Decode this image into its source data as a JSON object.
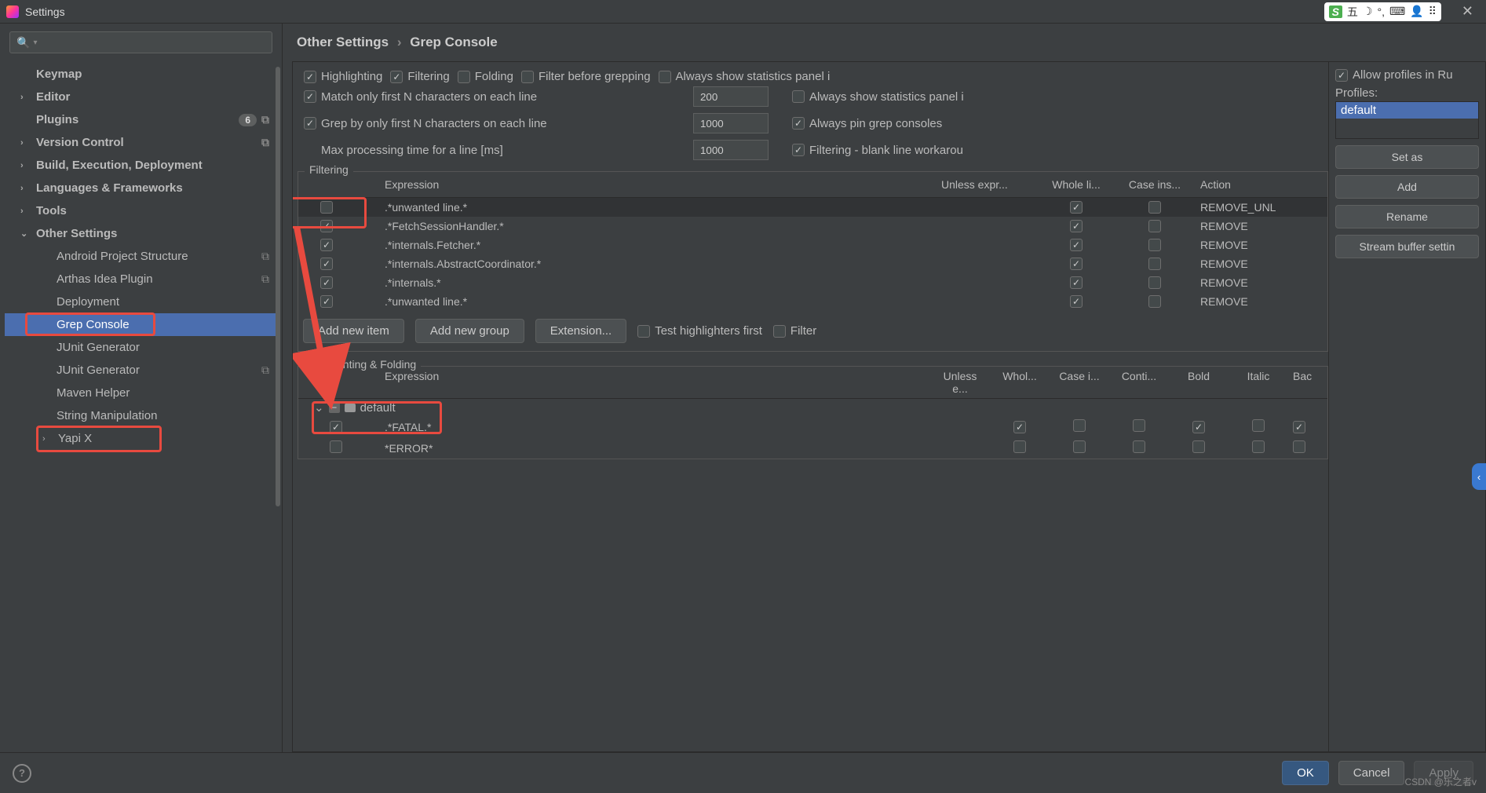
{
  "titlebar": {
    "title": "Settings"
  },
  "ime": {
    "items": [
      "五",
      "☽",
      "°,",
      "⌨",
      "👤",
      "⠿"
    ]
  },
  "sidebar": {
    "items": [
      {
        "label": "Keymap",
        "bold": true,
        "chev": "",
        "lvl": 1
      },
      {
        "label": "Editor",
        "bold": true,
        "chev": "›",
        "lvl": 1
      },
      {
        "label": "Plugins",
        "bold": true,
        "chev": "",
        "lvl": 1,
        "badge": "6",
        "overlay": true
      },
      {
        "label": "Version Control",
        "bold": true,
        "chev": "›",
        "lvl": 1,
        "overlay": true
      },
      {
        "label": "Build, Execution, Deployment",
        "bold": true,
        "chev": "›",
        "lvl": 1
      },
      {
        "label": "Languages & Frameworks",
        "bold": true,
        "chev": "›",
        "lvl": 1
      },
      {
        "label": "Tools",
        "bold": true,
        "chev": "›",
        "lvl": 1
      },
      {
        "label": "Other Settings",
        "bold": true,
        "chev": "⌄",
        "lvl": 1
      },
      {
        "label": "Android Project Structure",
        "lvl": 2,
        "overlay": true
      },
      {
        "label": "Arthas Idea Plugin",
        "lvl": 2,
        "overlay": true
      },
      {
        "label": "Deployment",
        "lvl": 2
      },
      {
        "label": "Grep Console",
        "lvl": 2,
        "selected": true
      },
      {
        "label": "JUnit Generator",
        "lvl": 2
      },
      {
        "label": "JUnit Generator",
        "lvl": 2,
        "overlay": true
      },
      {
        "label": "Maven Helper",
        "lvl": 2
      },
      {
        "label": "String Manipulation",
        "lvl": 2
      },
      {
        "label": "Yapi X",
        "lvl": 2,
        "chev": "›"
      }
    ]
  },
  "breadcrumb": {
    "a": "Other Settings",
    "b": "Grep Console"
  },
  "options": {
    "row1": [
      {
        "checked": true,
        "label": "Highlighting"
      },
      {
        "checked": true,
        "label": "Filtering"
      },
      {
        "checked": false,
        "label": "Folding"
      },
      {
        "checked": false,
        "label": "Filter before grepping"
      },
      {
        "checked": false,
        "label": "Always show statistics panel i"
      }
    ],
    "row2": {
      "match_label": "Match only first N characters on each line",
      "match_checked": true,
      "match_value": "200",
      "stats2_checked": false,
      "stats2_label": "Always show statistics panel i"
    },
    "row3": {
      "grep_label": "Grep by only first N characters on each line",
      "grep_checked": true,
      "grep_value": "1000",
      "pin_checked": true,
      "pin_label": "Always pin grep consoles"
    },
    "row4": {
      "time_label": "Max processing time for a line [ms]",
      "time_value": "1000",
      "blank_checked": true,
      "blank_label": "Filtering - blank line workarou"
    }
  },
  "filtering": {
    "title": "Filtering",
    "headers": {
      "expr": "Expression",
      "unless": "Unless expr...",
      "whole": "Whole li...",
      "case": "Case ins...",
      "action": "Action"
    },
    "rows": [
      {
        "on": false,
        "expr": ".*unwanted line.*",
        "whole": true,
        "case": false,
        "action": "REMOVE_UNL",
        "dark": true
      },
      {
        "on": true,
        "expr": ".*FetchSessionHandler.*",
        "whole": true,
        "case": false,
        "action": "REMOVE"
      },
      {
        "on": true,
        "expr": ".*internals.Fetcher.*",
        "whole": true,
        "case": false,
        "action": "REMOVE"
      },
      {
        "on": true,
        "expr": ".*internals.AbstractCoordinator.*",
        "whole": true,
        "case": false,
        "action": "REMOVE"
      },
      {
        "on": true,
        "expr": ".*internals.*",
        "whole": true,
        "case": false,
        "action": "REMOVE"
      },
      {
        "on": true,
        "expr": ".*unwanted line.*",
        "whole": true,
        "case": false,
        "action": "REMOVE"
      }
    ],
    "buttons": {
      "add_item": "Add new item",
      "add_group": "Add new group",
      "extension": "Extension..."
    },
    "test_label": "Test highlighters first",
    "test_checked": false,
    "filter_label": "Filter",
    "filter_checked": false
  },
  "hf": {
    "title": "Highlighting & Folding",
    "headers": {
      "expr": "Expression",
      "unless": "Unless e...",
      "whole": "Whol...",
      "case": "Case i...",
      "cont": "Conti...",
      "bold": "Bold",
      "italic": "Italic",
      "bac": "Bac"
    },
    "folder": "default",
    "rows": [
      {
        "on": true,
        "expr": ".*FATAL.*",
        "whole": true,
        "case": false,
        "cont": false,
        "bold": true,
        "italic": false,
        "bac": true
      },
      {
        "on": false,
        "expr": "*ERROR*",
        "whole": false,
        "case": false,
        "cont": false,
        "bold": false,
        "italic": false,
        "bac": false
      }
    ]
  },
  "right": {
    "allow_label": "Allow profiles in Ru",
    "allow_checked": true,
    "profiles_label": "Profiles:",
    "profile_selected": "default",
    "buttons": {
      "setas": "Set as",
      "add": "Add",
      "rename": "Rename",
      "stream": "Stream buffer settin"
    }
  },
  "bottom": {
    "ok": "OK",
    "cancel": "Cancel",
    "apply": "Apply"
  },
  "watermark": "CSDN @乐之者v"
}
